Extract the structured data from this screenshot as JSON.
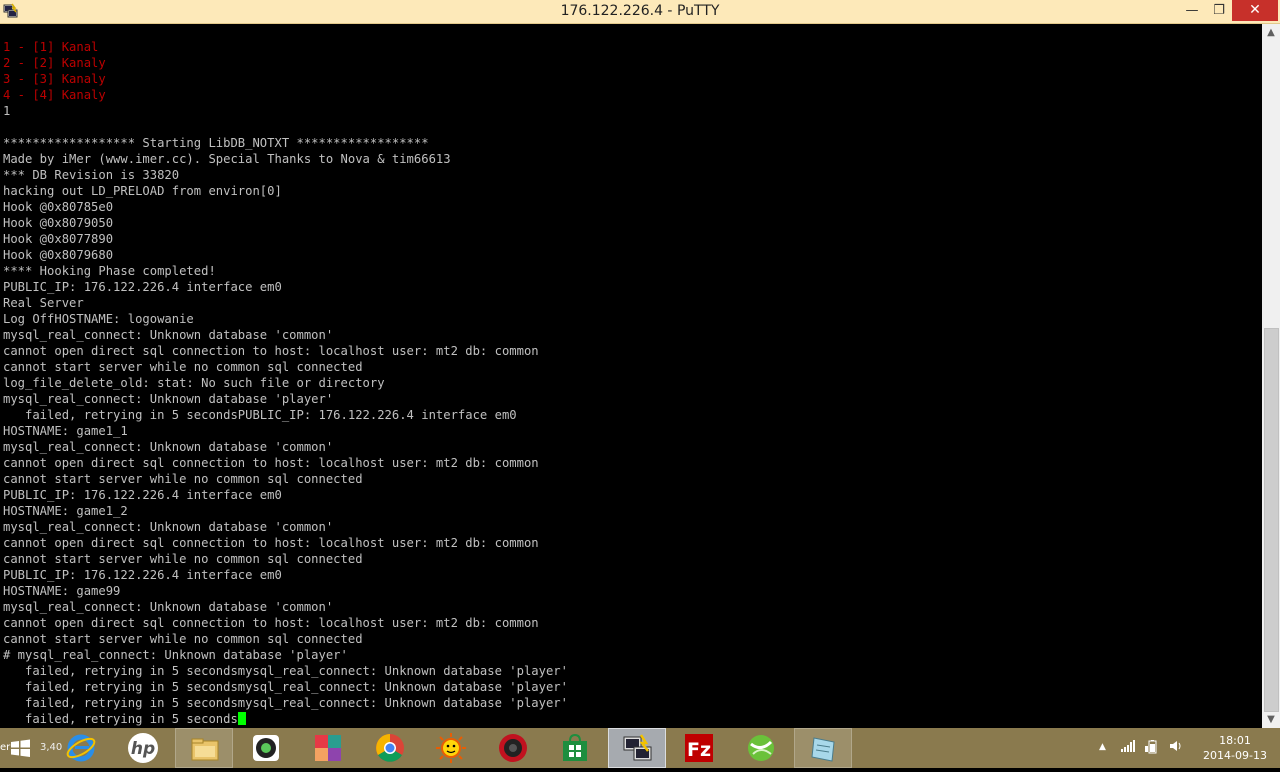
{
  "window": {
    "title": "176.122.226.4 - PuTTY",
    "minimize_label": "—",
    "maximize_label": "❐",
    "close_label": "✕"
  },
  "terminal": {
    "lines": [
      {
        "text": "1 - [1] Kanal",
        "color": "red"
      },
      {
        "text": "2 - [2] Kanaly",
        "color": "red"
      },
      {
        "text": "3 - [3] Kanaly",
        "color": "red"
      },
      {
        "text": "4 - [4] Kanaly",
        "color": "red"
      },
      {
        "text": "1",
        "color": "default"
      },
      {
        "text": "",
        "color": "default"
      },
      {
        "text": "****************** Starting LibDB_NOTXT ******************",
        "color": "default"
      },
      {
        "text": "Made by iMer (www.imer.cc). Special Thanks to Nova & tim66613",
        "color": "default"
      },
      {
        "text": "*** DB Revision is 33820",
        "color": "default"
      },
      {
        "text": "hacking out LD_PRELOAD from environ[0]",
        "color": "default"
      },
      {
        "text": "Hook @0x80785e0",
        "color": "default"
      },
      {
        "text": "Hook @0x8079050",
        "color": "default"
      },
      {
        "text": "Hook @0x8077890",
        "color": "default"
      },
      {
        "text": "Hook @0x8079680",
        "color": "default"
      },
      {
        "text": "**** Hooking Phase completed!",
        "color": "default"
      },
      {
        "text": "PUBLIC_IP: 176.122.226.4 interface em0",
        "color": "default"
      },
      {
        "text": "Real Server",
        "color": "default"
      },
      {
        "text": "Log OffHOSTNAME: logowanie",
        "color": "default"
      },
      {
        "text": "mysql_real_connect: Unknown database 'common'",
        "color": "default"
      },
      {
        "text": "cannot open direct sql connection to host: localhost user: mt2 db: common",
        "color": "default"
      },
      {
        "text": "cannot start server while no common sql connected",
        "color": "default"
      },
      {
        "text": "log_file_delete_old: stat: No such file or directory",
        "color": "default"
      },
      {
        "text": "mysql_real_connect: Unknown database 'player'",
        "color": "default"
      },
      {
        "text": "   failed, retrying in 5 secondsPUBLIC_IP: 176.122.226.4 interface em0",
        "color": "default"
      },
      {
        "text": "HOSTNAME: game1_1",
        "color": "default"
      },
      {
        "text": "mysql_real_connect: Unknown database 'common'",
        "color": "default"
      },
      {
        "text": "cannot open direct sql connection to host: localhost user: mt2 db: common",
        "color": "default"
      },
      {
        "text": "cannot start server while no common sql connected",
        "color": "default"
      },
      {
        "text": "PUBLIC_IP: 176.122.226.4 interface em0",
        "color": "default"
      },
      {
        "text": "HOSTNAME: game1_2",
        "color": "default"
      },
      {
        "text": "mysql_real_connect: Unknown database 'common'",
        "color": "default"
      },
      {
        "text": "cannot open direct sql connection to host: localhost user: mt2 db: common",
        "color": "default"
      },
      {
        "text": "cannot start server while no common sql connected",
        "color": "default"
      },
      {
        "text": "PUBLIC_IP: 176.122.226.4 interface em0",
        "color": "default"
      },
      {
        "text": "HOSTNAME: game99",
        "color": "default"
      },
      {
        "text": "mysql_real_connect: Unknown database 'common'",
        "color": "default"
      },
      {
        "text": "cannot open direct sql connection to host: localhost user: mt2 db: common",
        "color": "default"
      },
      {
        "text": "cannot start server while no common sql connected",
        "color": "default"
      },
      {
        "text": "# mysql_real_connect: Unknown database 'player'",
        "color": "default"
      },
      {
        "text": "   failed, retrying in 5 secondsmysql_real_connect: Unknown database 'player'",
        "color": "default"
      },
      {
        "text": "   failed, retrying in 5 secondsmysql_real_connect: Unknown database 'player'",
        "color": "default"
      },
      {
        "text": "   failed, retrying in 5 secondsmysql_real_connect: Unknown database 'player'",
        "color": "default"
      },
      {
        "text": "   failed, retrying in 5 seconds",
        "color": "default",
        "cursor": true
      }
    ],
    "colors": {
      "default": "#c0c0c0",
      "red": "#bb0000",
      "cursor": "#00ff00",
      "background": "#000000"
    }
  },
  "scrollbar": {
    "up_arrow": "▲",
    "down_arrow": "▼",
    "position_fraction": 0.6
  },
  "taskbar": {
    "start_partial_text": "er",
    "start_partial_text2": "3,40",
    "apps": [
      {
        "name": "internet-explorer",
        "icon": "ie-icon",
        "open": false
      },
      {
        "name": "hp",
        "icon": "hp-icon",
        "open": false
      },
      {
        "name": "file-explorer",
        "icon": "folder-icon",
        "open": true
      },
      {
        "name": "camera-app",
        "icon": "camera-icon",
        "open": false
      },
      {
        "name": "puzzle-app",
        "icon": "puzzle-icon",
        "open": false
      },
      {
        "name": "chrome",
        "icon": "chrome-icon",
        "open": false
      },
      {
        "name": "sun-app",
        "icon": "sun-icon",
        "open": false
      },
      {
        "name": "media-app",
        "icon": "media-icon",
        "open": false
      },
      {
        "name": "store",
        "icon": "store-icon",
        "open": false
      },
      {
        "name": "putty",
        "icon": "putty-icon",
        "open": true,
        "active": true
      },
      {
        "name": "filezilla",
        "icon": "filezilla-icon",
        "open": false
      },
      {
        "name": "green-app",
        "icon": "green-ball-icon",
        "open": false
      },
      {
        "name": "notes-app",
        "icon": "notes-icon",
        "open": true
      }
    ],
    "tray": {
      "show_hidden": "▲",
      "signal": "📶",
      "battery": "▮",
      "volume": "🔈"
    },
    "clock": {
      "time": "18:01",
      "date": "2014-09-13"
    }
  }
}
